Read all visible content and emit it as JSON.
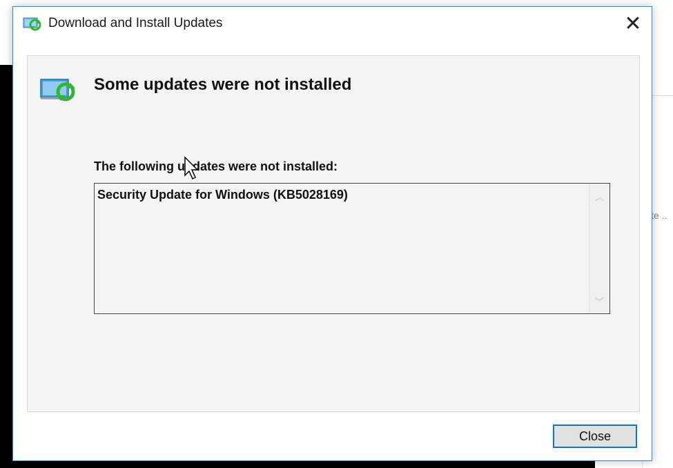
{
  "background": {
    "right_window_text": "te .."
  },
  "dialog": {
    "title": "Download and Install Updates",
    "close_glyph": "✕",
    "icon": "windows-update-icon",
    "heading": "Some updates were not installed",
    "list_label": "The following updates were not installed:",
    "failed_updates": [
      "Security Update for Windows (KB5028169)"
    ],
    "scroll_up_glyph": "︿",
    "scroll_down_glyph": "﹀",
    "close_button_label": "Close"
  },
  "colors": {
    "accent": "#0078d7",
    "window_border": "#1e8ed9",
    "content_bg": "#f4f4f4"
  }
}
